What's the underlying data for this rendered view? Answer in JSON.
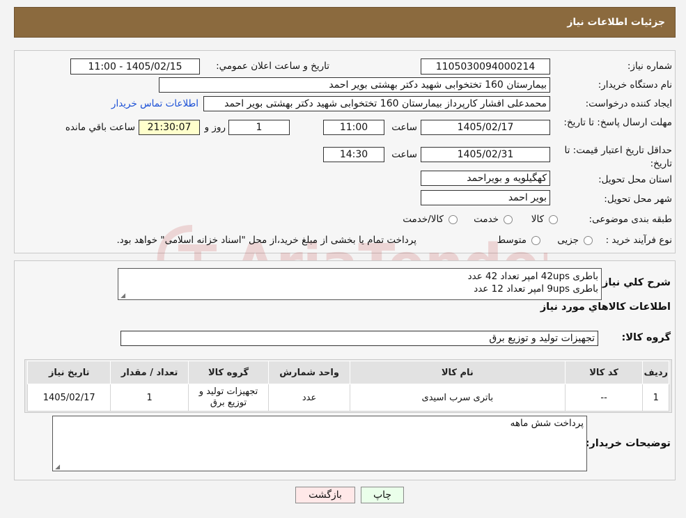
{
  "header": {
    "title": "جزئیات اطلاعات نیاز"
  },
  "form": {
    "need_number_label": "شماره نیاز:",
    "need_number": "1105030094000214",
    "announce_label": "تاریخ و ساعت اعلان عمومي:",
    "announce_value": "1405/02/15 - 11:00",
    "buyer_org_label": "نام دستگاه خریدار:",
    "buyer_org": "بیمارستان 160 تختخوابی شهید دکتر بهشتی بویر احمد",
    "requester_label": "ایجاد کننده درخواست:",
    "requester": "محمدعلی افشار کارپرداز بیمارستان 160 تختخوابی شهید دکتر بهشتی بویر احمد",
    "contact_link": "اطلاعات تماس خریدار",
    "send_deadline_label": "مهلت ارسال پاسخ: تا تاریخ:",
    "send_date": "1405/02/17",
    "time_label": "ساعت",
    "send_time": "11:00",
    "days_count": "1",
    "days_label": "روز و",
    "remaining_time": "21:30:07",
    "remaining_label": "ساعت باقي مانده",
    "validity_label": "حداقل تاریخ اعتبار قیمت: تا تاریخ:",
    "validity_date": "1405/02/31",
    "validity_time": "14:30",
    "province_label": "استان محل تحویل:",
    "province": "کهگیلویه و بویراحمد",
    "city_label": "شهر محل تحویل:",
    "city": "بویر احمد",
    "category_label": "طبقه بندی موضوعی:",
    "category_options": [
      "کالا",
      "خدمت",
      "کالا/خدمت"
    ],
    "process_label": "نوع فرآیند خرید :",
    "process_options": [
      "جزیی",
      "متوسط"
    ],
    "process_note": "پرداخت تمام یا بخشی از مبلغ خرید،از محل \"اسناد خزانه اسلامی\" خواهد بود."
  },
  "description": {
    "label": "شرح کلي نیاز:",
    "line1": "باطری 42ups امپر تعداد 42 عدد",
    "line2": "باطری  9ups امپر تعداد 12 عدد"
  },
  "goods_section": {
    "title": "اطلاعات کالاهاي مورد نیاز",
    "group_label": "گروه کالا:",
    "group_value": "تجهیزات تولید و توزیع برق"
  },
  "table": {
    "headers": [
      "ردیف",
      "کد کالا",
      "نام کالا",
      "واحد شمارش",
      "گروه کالا",
      "تعداد / مقدار",
      "تاریخ نیاز"
    ],
    "rows": [
      {
        "row": "1",
        "code": "--",
        "name": "باتری سرب اسیدی",
        "unit": "عدد",
        "group": "تجهیزات تولید و توزیع برق",
        "qty": "1",
        "date": "1405/02/17"
      }
    ]
  },
  "buyer_notes": {
    "label": "توضیحات خریدار:",
    "text": "پرداخت شش ماهه"
  },
  "buttons": {
    "print": "چاپ",
    "back": "بازگشت"
  },
  "watermark": {
    "text": "AriaTender.neT"
  },
  "colors": {
    "header": "#8b6a3e",
    "link": "#1a4fd6",
    "highlight": "#ffffcc",
    "print_button": "#eaffea",
    "back_button": "#ffe8e8"
  }
}
